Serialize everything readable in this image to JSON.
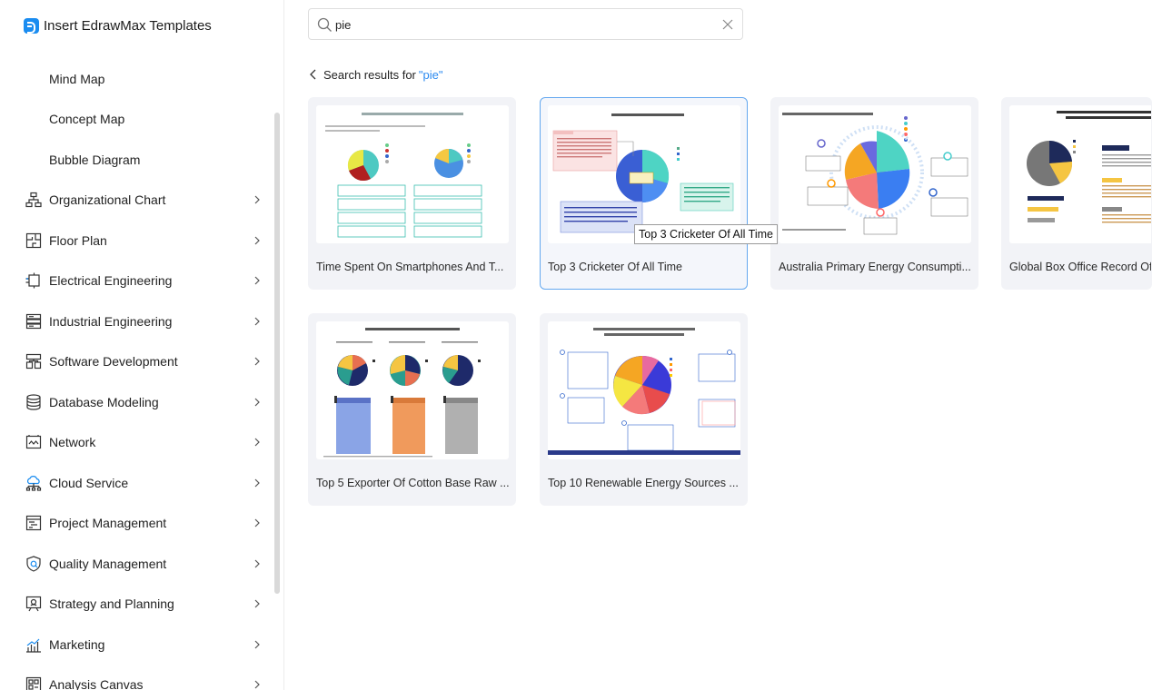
{
  "sidebar": {
    "title": "Insert EdrawMax Templates",
    "sub_items": [
      {
        "label": "Mind Map"
      },
      {
        "label": "Concept Map"
      },
      {
        "label": "Bubble Diagram"
      }
    ],
    "items": [
      {
        "label": "Organizational Chart",
        "icon": "org-chart-icon"
      },
      {
        "label": "Floor Plan",
        "icon": "floor-plan-icon"
      },
      {
        "label": "Electrical Engineering",
        "icon": "electrical-icon"
      },
      {
        "label": "Industrial Engineering",
        "icon": "industrial-icon"
      },
      {
        "label": "Software Development",
        "icon": "software-icon"
      },
      {
        "label": "Database Modeling",
        "icon": "database-icon"
      },
      {
        "label": "Network",
        "icon": "network-icon"
      },
      {
        "label": "Cloud Service",
        "icon": "cloud-icon"
      },
      {
        "label": "Project Management",
        "icon": "project-icon"
      },
      {
        "label": "Quality Management",
        "icon": "quality-icon"
      },
      {
        "label": "Strategy and Planning",
        "icon": "strategy-icon"
      },
      {
        "label": "Marketing",
        "icon": "marketing-icon"
      },
      {
        "label": "Analysis Canvas",
        "icon": "analysis-icon"
      }
    ]
  },
  "search": {
    "value": "pie",
    "placeholder": ""
  },
  "results": {
    "prefix": "Search results for",
    "query": "\"pie\""
  },
  "cards": [
    {
      "title": "Time Spent On Smartphones And T..."
    },
    {
      "title": "Top 3 Cricketer Of All Time"
    },
    {
      "title": "Australia Primary Energy Consumpti..."
    },
    {
      "title": "Global Box Office Record Of"
    },
    {
      "title": "Top 5 Exporter Of Cotton Base Raw ..."
    },
    {
      "title": "Top 10 Renewable Energy Sources ..."
    }
  ],
  "tooltip": "Top 3 Cricketer Of All Time",
  "colors": {
    "accent": "#2b8af0",
    "card_bg": "#f2f3f7",
    "selected_border": "#64a8ef"
  }
}
